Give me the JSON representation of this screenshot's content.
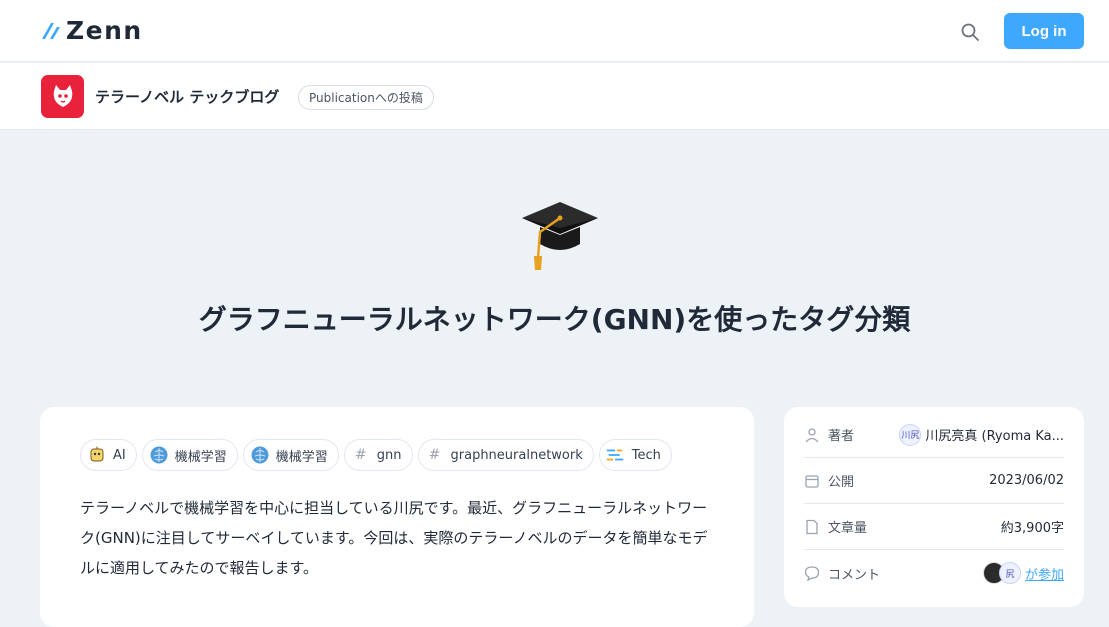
{
  "header": {
    "logo_text": "Zenn",
    "login_label": "Log in"
  },
  "publication": {
    "name": "テラーノベル テックブログ",
    "badge": "Publicationへの投稿"
  },
  "article": {
    "emoji": "graduation-cap",
    "title": "グラフニューラルネットワーク(GNN)を使ったタグ分類",
    "tags": [
      {
        "label": "AI",
        "icon": "ai-icon"
      },
      {
        "label": "機械学習",
        "icon": "brain-icon"
      },
      {
        "label": "機械学習",
        "icon": "brain-icon"
      },
      {
        "label": "gnn",
        "icon": "hash-icon"
      },
      {
        "label": "graphneuralnetwork",
        "icon": "hash-icon"
      },
      {
        "label": "Tech",
        "icon": "tech-icon"
      }
    ],
    "body": "テラーノベルで機械学習を中心に担当している川尻です。最近、グラフニューラルネットワーク(GNN)に注目してサーベイしています。今回は、実際のテラーノベルのデータを簡単なモデルに適用してみたので報告します。"
  },
  "sidebar": {
    "author_label": "著者",
    "author_name": "川尻亮真 (Ryoma Ka...",
    "author_avatar_text": "川尻",
    "published_label": "公開",
    "published_date": "2023/06/02",
    "wordcount_label": "文章量",
    "wordcount_value": "約3,900字",
    "comment_label": "コメント",
    "comment_avatar_text": "尻",
    "comment_value": "が参加"
  },
  "colors": {
    "accent": "#3ea8ff",
    "publication_brand": "#e9223c",
    "page_background": "#edf2f7"
  }
}
